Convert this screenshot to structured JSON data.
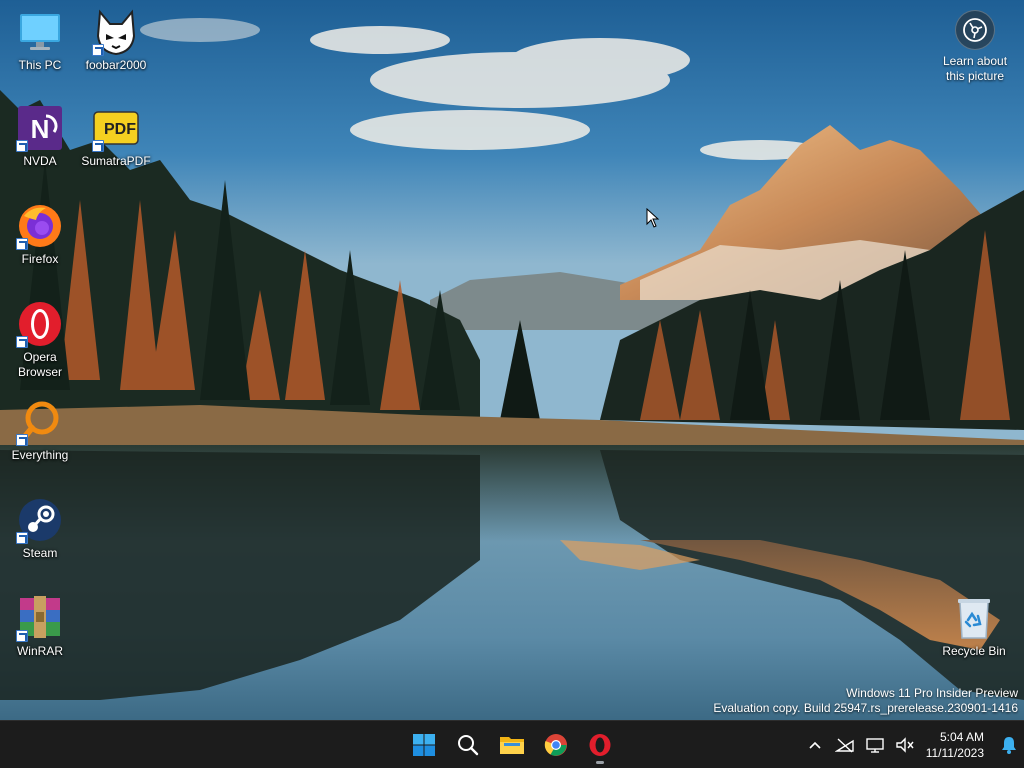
{
  "desktop": {
    "icons_left": [
      {
        "label": "This PC",
        "icon": "this-pc-icon"
      },
      {
        "label": "NVDA",
        "icon": "nvda-icon"
      },
      {
        "label": "Firefox",
        "icon": "firefox-icon"
      },
      {
        "label": "Opera Browser",
        "icon": "opera-icon"
      },
      {
        "label": "Everything",
        "icon": "everything-icon"
      },
      {
        "label": "Steam",
        "icon": "steam-icon"
      },
      {
        "label": "WinRAR",
        "icon": "winrar-icon"
      }
    ],
    "icons_second": [
      {
        "label": "foobar2000",
        "icon": "foobar2000-icon"
      },
      {
        "label": "SumatraPDF",
        "icon": "sumatrapdf-icon",
        "badge": "PDF"
      }
    ],
    "recycle_bin": {
      "label": "Recycle Bin",
      "icon": "recycle-bin-icon"
    },
    "spotlight": {
      "label_line1": "Learn about",
      "label_line2": "this picture",
      "icon": "camera-icon"
    },
    "watermark": {
      "line1": "Windows 11 Pro Insider Preview",
      "line2": "Evaluation copy. Build 25947.rs_prerelease.230901-1416"
    }
  },
  "taskbar": {
    "apps": [
      {
        "name": "Start",
        "icon": "windows-start-icon"
      },
      {
        "name": "Search",
        "icon": "search-icon"
      },
      {
        "name": "File Explorer",
        "icon": "folder-icon"
      },
      {
        "name": "Chrome",
        "icon": "chrome-icon"
      },
      {
        "name": "Opera",
        "icon": "opera-icon",
        "active": true
      }
    ],
    "tray_icons": [
      "chevron-up-icon",
      "network-off-icon",
      "display-icon",
      "volume-muted-icon"
    ],
    "clock": {
      "time": "5:04 AM",
      "date": "11/11/2023"
    },
    "notification_icon": "bell-icon"
  },
  "colors": {
    "taskbar_bg": "#1c1c1c",
    "accent": "#0078d4",
    "opera_red": "#e21e2c"
  }
}
